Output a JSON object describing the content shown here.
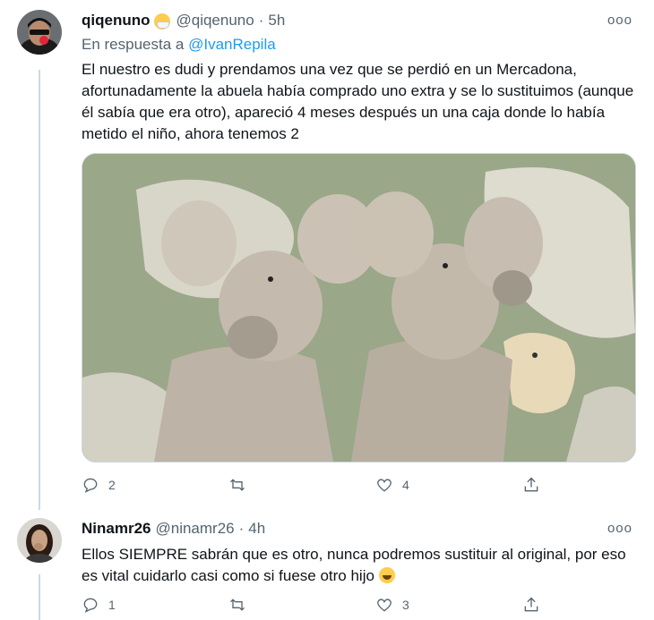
{
  "tweets": [
    {
      "display_name": "qiqenuno",
      "handle": "@qiqenuno",
      "sep": "·",
      "time": "5h",
      "reply_prefix": "En respuesta a",
      "reply_to": "@IvanRepila",
      "body": "El nuestro es dudi y prendamos una vez que se perdió en un Mercadona, afortunadamente la abuela había comprado uno extra y se lo sustituimos (aunque él sabía que era otro), apareció 4 meses después un una caja donde lo había metido el niño, ahora tenemos 2",
      "replies": "2",
      "retweets": "",
      "likes": "4"
    },
    {
      "display_name": "Ninamr26",
      "handle": "@ninamr26",
      "sep": "·",
      "time": "4h",
      "body": "Ellos SIEMPRE sabrán que es otro, nunca podremos sustituir al original, por eso es vital cuidarlo casi como si fuese otro hijo",
      "replies": "1",
      "retweets": "",
      "likes": "3"
    }
  ],
  "more_glyph": "ooo",
  "icons": [
    "reply-icon",
    "retweet-icon",
    "like-icon",
    "share-icon",
    "more-icon"
  ],
  "colors": {
    "link": "#1d9bf0",
    "muted": "#536471",
    "thread_line": "#cfd9de"
  }
}
